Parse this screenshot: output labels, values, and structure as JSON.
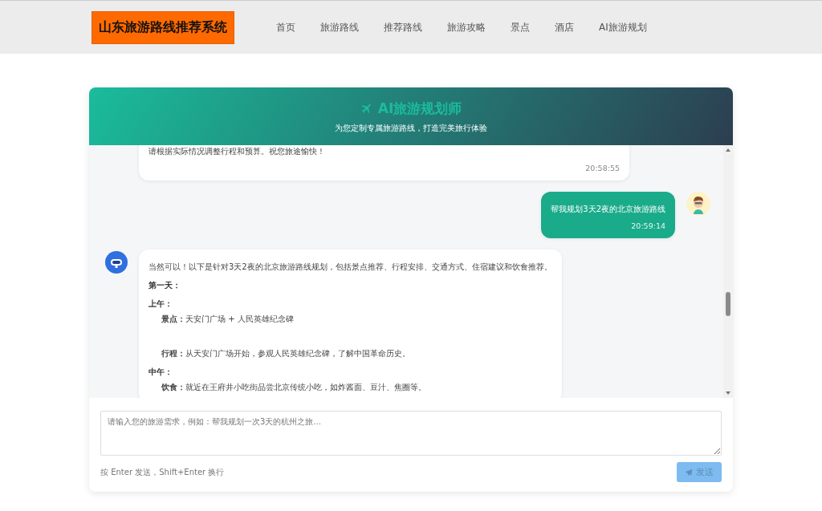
{
  "site": {
    "logo": "山东旅游路线推荐系统",
    "nav": [
      {
        "label": "首页"
      },
      {
        "label": "旅游路线"
      },
      {
        "label": "推荐路线"
      },
      {
        "label": "旅游攻略"
      },
      {
        "label": "景点"
      },
      {
        "label": "酒店"
      },
      {
        "label": "AI旅游规划"
      }
    ]
  },
  "chat_header": {
    "title": "AI旅游规划师",
    "subtitle": "为您定制专属旅游路线，打造完美旅行体验"
  },
  "messages": [
    {
      "kind": "bot",
      "lines": [
        {
          "kind": "text",
          "text": "请根据实际情况调整行程和预算。祝您旅途愉快！"
        }
      ],
      "time": "20:58:55"
    },
    {
      "kind": "user",
      "lines": [
        {
          "kind": "text",
          "text": "帮我规划3天2夜的北京旅游路线"
        }
      ],
      "time": "20:59:14"
    },
    {
      "kind": "bot",
      "lines": [
        {
          "kind": "text",
          "text": "当然可以！以下是针对3天2夜的北京旅游路线规划，包括景点推荐、行程安排、交通方式、住宿建议和饮食推荐。"
        },
        {
          "kind": "heading",
          "text": "第一天："
        },
        {
          "kind": "heading",
          "text": "上午："
        },
        {
          "kind": "item",
          "text": "**景点：**天安门广场 + 人民英雄纪念碑"
        },
        {
          "kind": "gap"
        },
        {
          "kind": "item",
          "text": "**行程：**从天安门广场开始，参观人民英雄纪念碑，了解中国革命历史。"
        },
        {
          "kind": "heading",
          "text": "中午："
        },
        {
          "kind": "item",
          "text": "**饮食：**就近在王府井小吃街品尝北京传统小吃，如炸酱面、豆汁、焦圈等。"
        }
      ]
    }
  ],
  "composer": {
    "placeholder": "请输入您的旅游需求，例如：帮我规划一次3天的杭州之旅...",
    "hint": "按 Enter 发送，Shift+Enter 换行",
    "send_label": "发送",
    "send_disabled": true
  }
}
